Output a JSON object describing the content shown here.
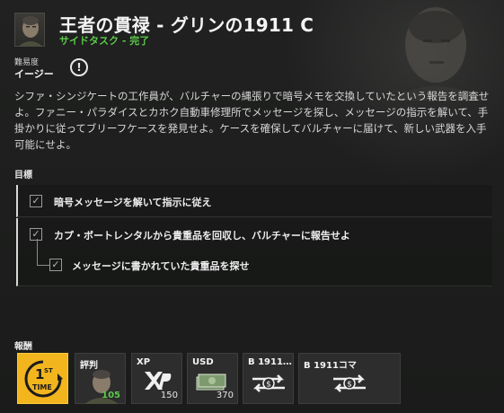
{
  "header": {
    "title": "王者の貫禄 - グリンの1911 C",
    "subtitle": "サイドタスク - 完了"
  },
  "difficulty": {
    "label": "難易度",
    "value": "イージー",
    "info_icon": "!"
  },
  "description": "シファ・シンジケートの工作員が、バルチャーの縄張りで暗号メモを交換していたという報告を調査せよ。ファニー・パラダイスとカホク自動車修理所でメッセージを探し、メッセージの指示を解いて、手掛かりに従ってブリーフケースを発見せよ。ケースを確保してバルチャーに届けて、新しい武器を入手可能にせよ。",
  "objectives": {
    "label": "目標",
    "items": [
      {
        "text": "暗号メッセージを解いて指示に従え",
        "done": true
      },
      {
        "text": "カプ・ボートレンタルから貴重品を回収し、バルチャーに報告せよ",
        "done": true
      },
      {
        "text": "メッセージに書かれていた貴重品を探せ",
        "done": true
      }
    ],
    "check_glyph": "✓"
  },
  "rewards": {
    "label": "報酬",
    "first_time": {
      "top": "1",
      "sup": "ST",
      "bottom": "TIME"
    },
    "reputation": {
      "label": "評判",
      "amount": "105"
    },
    "xp": {
      "label": "XP",
      "amount": "150"
    },
    "usd": {
      "label": "USD",
      "amount": "370"
    },
    "blueprint1": {
      "label": "B 1911…"
    },
    "blueprint2": {
      "label": "B 1911コマ"
    }
  },
  "colors": {
    "complete_green": "#5cc84a",
    "first_time_gold": "#f2b51d",
    "background": "#1c1d1c"
  }
}
